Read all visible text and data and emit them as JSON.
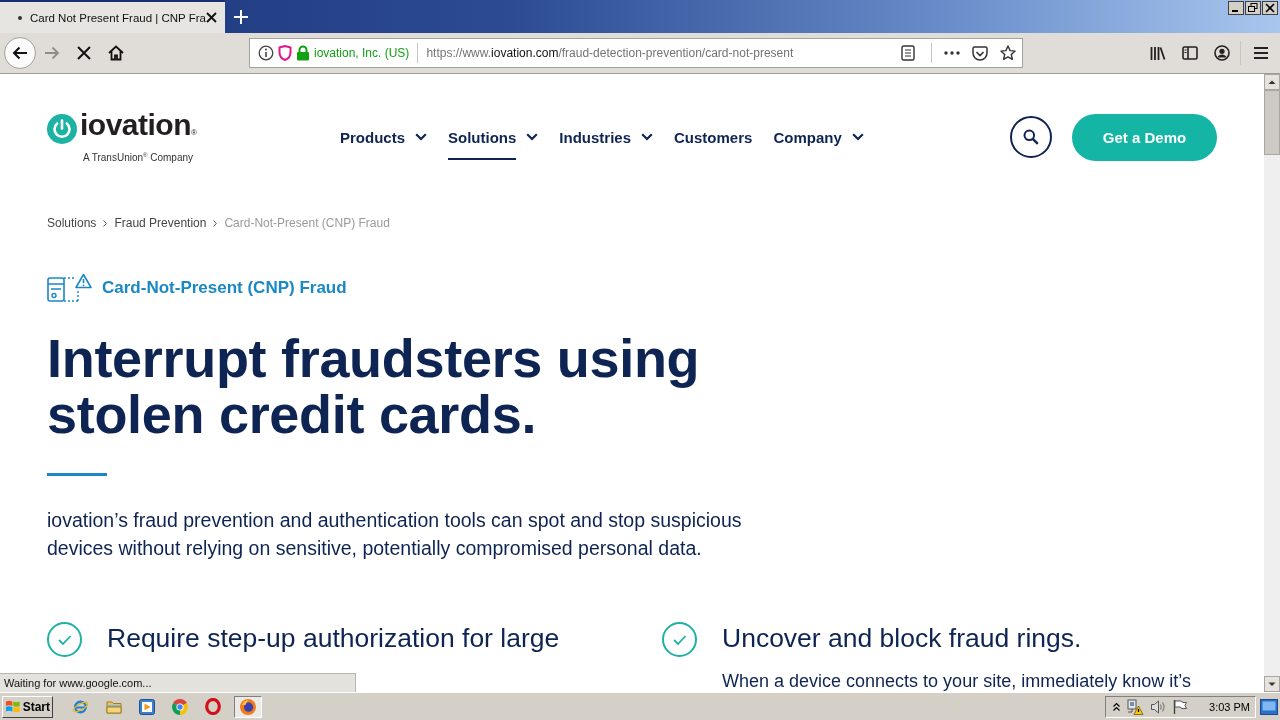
{
  "browser": {
    "loading": true,
    "forward_disabled": true,
    "tabs": [
      {
        "title": "Card Not Present Fraud | CNP Fra",
        "selected": true
      }
    ],
    "url_bar": {
      "identity": "iovation, Inc. (US)",
      "url_parts": [
        {
          "text": "https://www.",
          "emphasis": false
        },
        {
          "text": "iovation.com",
          "emphasis": true
        },
        {
          "text": "/fraud-detection-prevention/card-not-present",
          "emphasis": false
        }
      ]
    },
    "status": "Waiting for www.google.com..."
  },
  "page": {
    "logo": {
      "wordmark": "iovation$_{®}$",
      "tagline": "A TransUnion$^{®}$ Company"
    },
    "nav": [
      {
        "label": "Products",
        "has_menu": true,
        "selected": false
      },
      {
        "label": "Solutions",
        "has_menu": true,
        "selected": true
      },
      {
        "label": "Industries",
        "has_menu": true,
        "selected": false
      },
      {
        "label": "Customers",
        "has_menu": false,
        "selected": false
      },
      {
        "label": "Company",
        "has_menu": true,
        "selected": false
      }
    ],
    "demo_button": "Get a Demo",
    "breadcrumb": [
      {
        "label": "Solutions",
        "current": false
      },
      {
        "label": "Fraud Prevention",
        "current": false
      },
      {
        "label": "Card-Not-Present (CNP) Fraud",
        "current": true
      }
    ],
    "eyebrow": "Card-Not-Present (CNP) Fraud",
    "headline": "Interrupt fraudsters using stolen credit cards.",
    "intro": "iovation’s fraud prevention and authentication tools can spot and stop suspicious devices without relying on sensitive, potentially compromised personal data.",
    "features": [
      {
        "title": "Require step-up authorization for large"
      },
      {
        "title": "Uncover and block fraud rings.",
        "text": "When a device connects to your site, immediately know it’s"
      }
    ]
  },
  "taskbar": {
    "start": "Start",
    "apps": [
      {
        "kind": "ie",
        "active": false
      },
      {
        "kind": "folder",
        "active": false
      },
      {
        "kind": "media",
        "active": false
      },
      {
        "kind": "chrome",
        "active": false
      },
      {
        "kind": "opera",
        "active": false
      },
      {
        "kind": "firefox",
        "active": true
      }
    ],
    "clock": "3:03 PM"
  }
}
